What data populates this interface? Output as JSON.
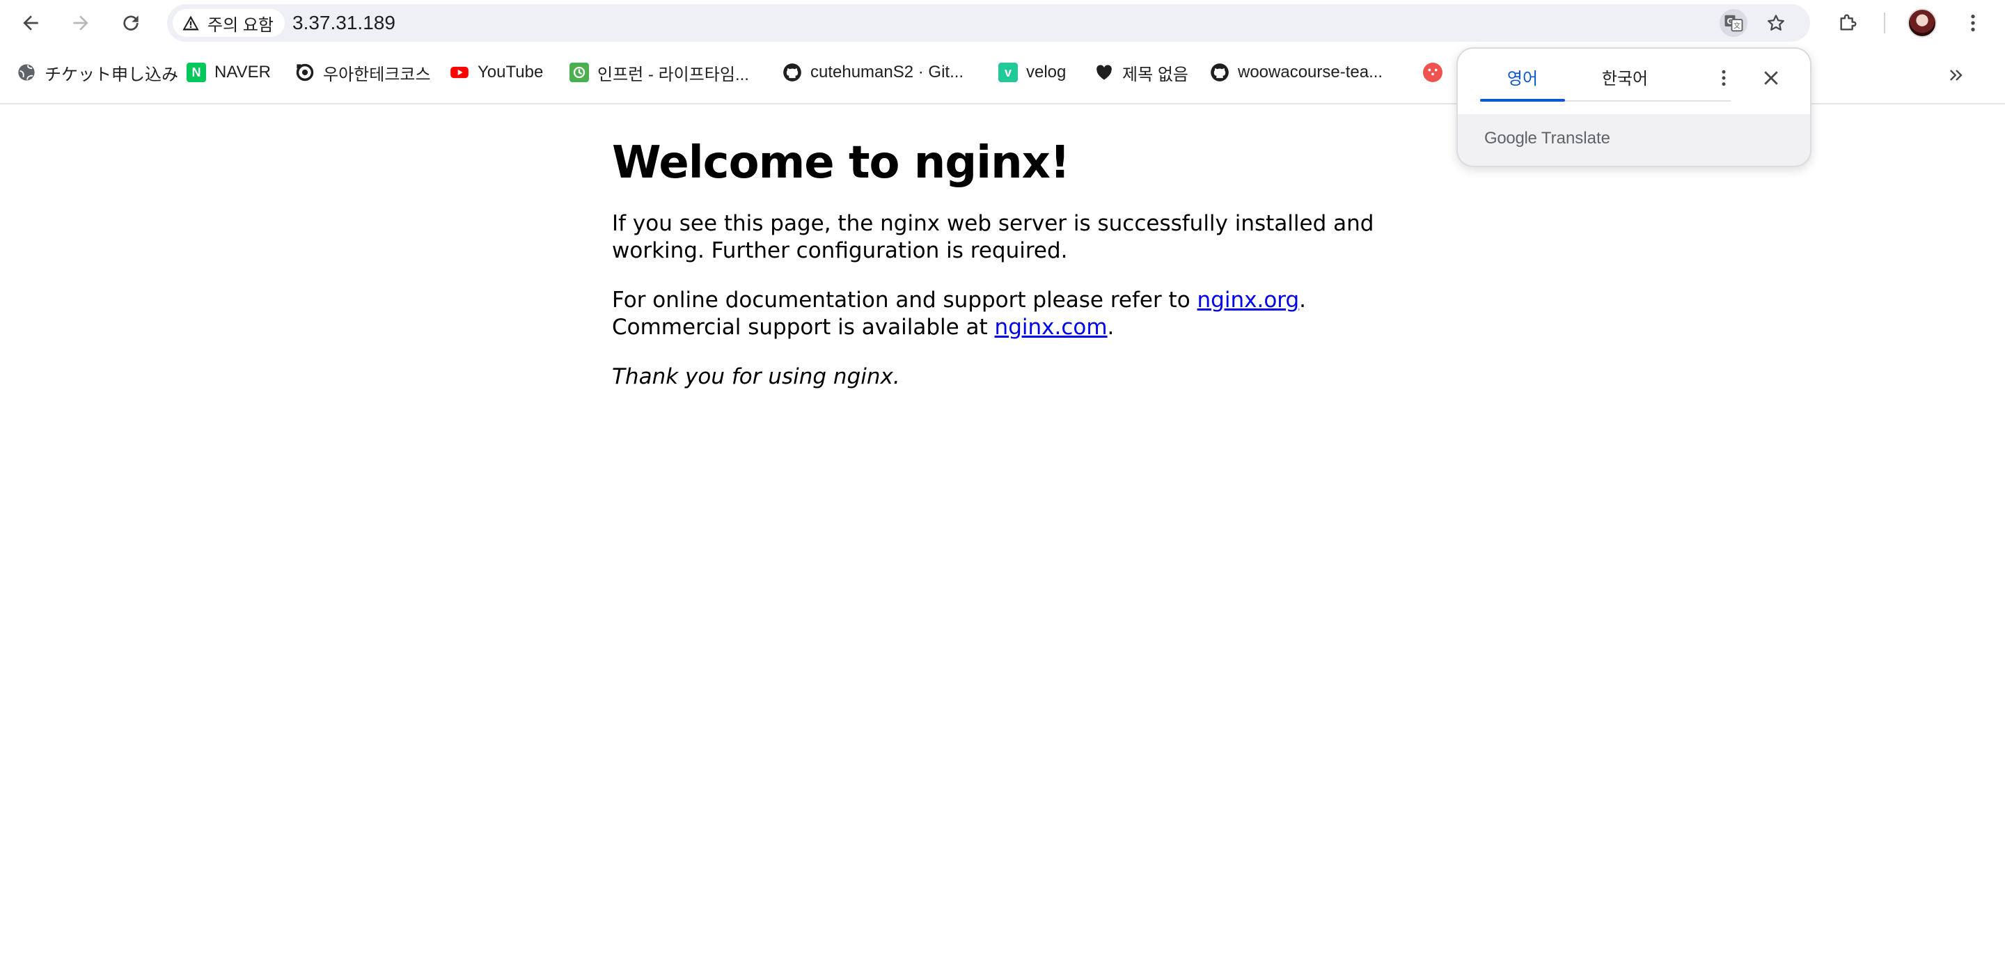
{
  "browser": {
    "security_label": "주의 요함",
    "url": "3.37.31.189",
    "accent_color": "#0b57d0"
  },
  "bookmarks": [
    {
      "label": "チケット申し込み",
      "icon": "globe-icon"
    },
    {
      "label": "NAVER",
      "icon": "naver-icon"
    },
    {
      "label": "우아한테크코스",
      "icon": "woowa-icon"
    },
    {
      "label": "YouTube",
      "icon": "youtube-icon"
    },
    {
      "label": "인프런 - 라이프타임...",
      "icon": "inflearn-icon"
    },
    {
      "label": "cutehumanS2 · Git...",
      "icon": "github-icon"
    },
    {
      "label": "velog",
      "icon": "velog-icon"
    },
    {
      "label": "제목 없음",
      "icon": "heart-icon"
    },
    {
      "label": "woowacourse-tea...",
      "icon": "github-icon"
    }
  ],
  "page": {
    "title": "Welcome to nginx!",
    "p1": "If you see this page, the nginx web server is successfully installed and working. Further configuration is required.",
    "p2_prefix": "For online documentation and support please refer to ",
    "p2_link1": "nginx.org",
    "p2_mid": ". Commercial support is available at ",
    "p2_link2": "nginx.com",
    "p2_suffix": ".",
    "p3": "Thank you for using nginx."
  },
  "translate": {
    "tab_source": "영어",
    "tab_target": "한국어",
    "brand_google": "Google",
    "brand_translate": "Translate"
  }
}
